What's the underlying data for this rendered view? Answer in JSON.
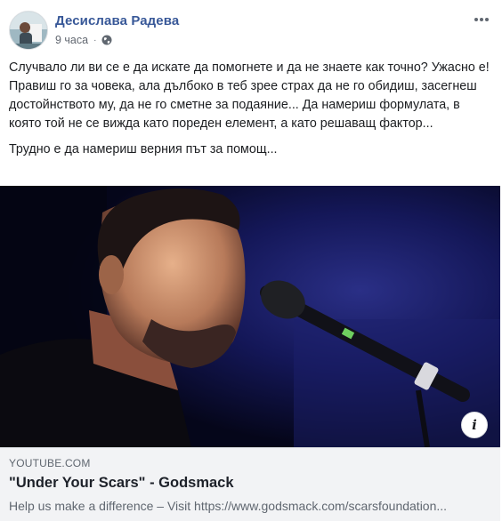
{
  "post": {
    "author": "Десислава Радева",
    "time": "9 часа",
    "privacy_icon": "globe-icon",
    "paragraphs": [
      "Случвало ли ви се е да искате да помогнете и да не знаете как точно? Ужасно е! Правиш го за човека, ала дълбоко в теб зрее страх да не го обидиш, засегнеш достойнството му, да не го сметне за подаяние... Да намериш формулата, в която той не се вижда като пореден елемент, а като решаващ фактор...",
      "Трудно е да намериш верния път за помощ..."
    ]
  },
  "link_preview": {
    "domain": "YOUTUBE.COM",
    "title": "\"Under Your Scars\" - Godsmack",
    "description": "Help us make a difference – Visit https://www.godsmack.com/scarsfoundation...",
    "info_label": "i"
  },
  "colors": {
    "author": "#385898",
    "link_box_bg": "#f2f3f5",
    "media_bg": "#07081c"
  }
}
